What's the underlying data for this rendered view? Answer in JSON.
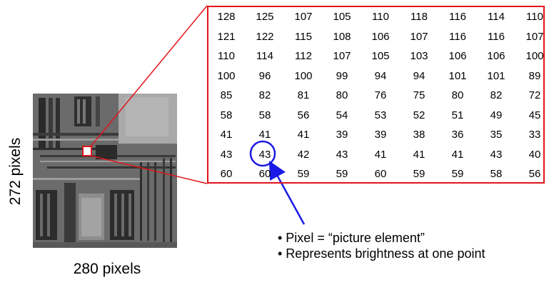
{
  "labels": {
    "height_pixels": "272 pixels",
    "width_pixels": "280 pixels"
  },
  "pixel_values": [
    [
      "128",
      "125",
      "107",
      "105",
      "110",
      "118",
      "116",
      "114",
      "110"
    ],
    [
      "121",
      "122",
      "115",
      "108",
      "106",
      "107",
      "116",
      "116",
      "107"
    ],
    [
      "110",
      "114",
      "112",
      "107",
      "105",
      "103",
      "106",
      "106",
      "100"
    ],
    [
      "100",
      "96",
      "100",
      "99",
      "94",
      "94",
      "101",
      "101",
      "89"
    ],
    [
      "85",
      "82",
      "81",
      "80",
      "76",
      "75",
      "80",
      "82",
      "72"
    ],
    [
      "58",
      "58",
      "56",
      "54",
      "53",
      "52",
      "51",
      "49",
      "45"
    ],
    [
      "41",
      "41",
      "41",
      "39",
      "39",
      "38",
      "36",
      "35",
      "33"
    ],
    [
      "43",
      "43",
      "42",
      "43",
      "41",
      "41",
      "41",
      "43",
      "40"
    ],
    [
      "60",
      "60",
      "59",
      "59",
      "60",
      "59",
      "59",
      "58",
      "56"
    ]
  ],
  "highlighted_cell": {
    "row": 7,
    "col": 1
  },
  "bullets": [
    "• Pixel = “picture element”",
    "• Represents brightness at one point"
  ],
  "colors": {
    "zoom_box": "#e0141b",
    "highlight_circle": "#1a1ae6",
    "arrow": "#1a1ae6"
  },
  "icons": {
    "photo": "grayscale-circuit-photo-icon"
  }
}
